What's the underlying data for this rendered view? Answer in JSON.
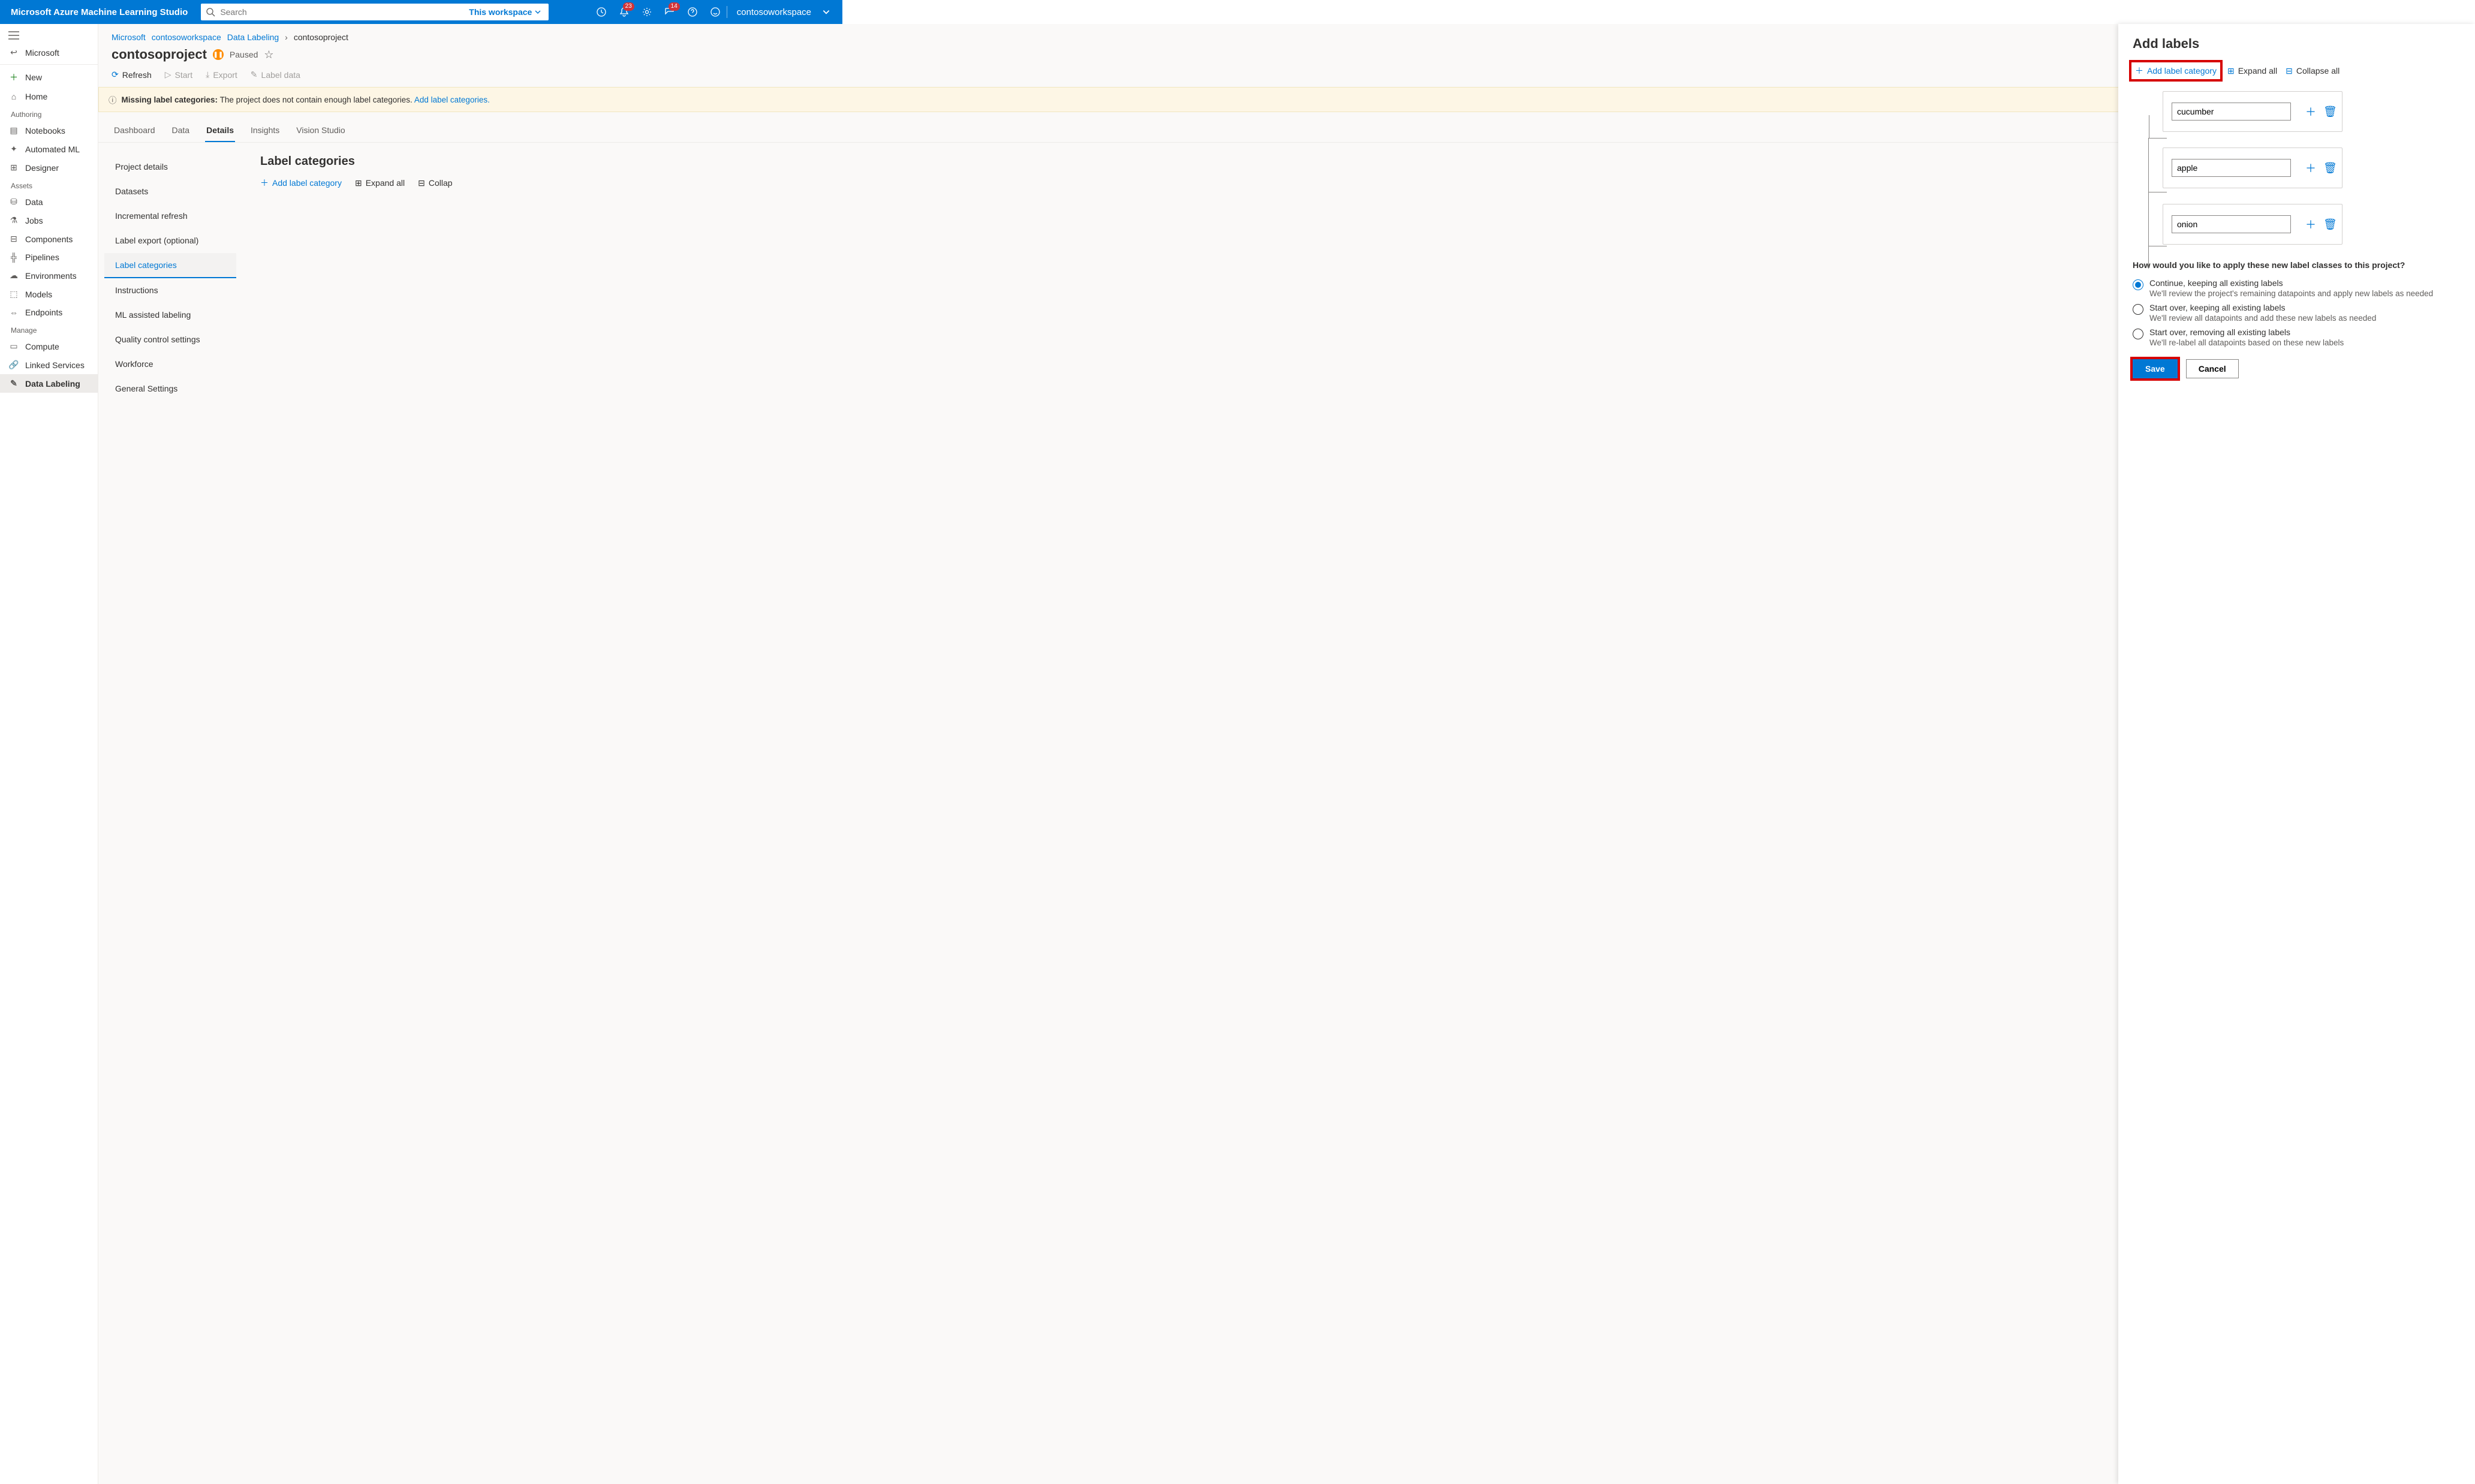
{
  "app_title": "Microsoft Azure Machine Learning Studio",
  "search": {
    "placeholder": "Search",
    "scope": "This workspace"
  },
  "topbar": {
    "bell_badge": "23",
    "feedback_badge": "14",
    "workspace": "contosoworkspace"
  },
  "leftnav": {
    "back": "Microsoft",
    "new": "New",
    "home": "Home",
    "sec_authoring": "Authoring",
    "notebooks": "Notebooks",
    "automl": "Automated ML",
    "designer": "Designer",
    "sec_assets": "Assets",
    "data": "Data",
    "jobs": "Jobs",
    "components": "Components",
    "pipelines": "Pipelines",
    "environments": "Environments",
    "models": "Models",
    "endpoints": "Endpoints",
    "sec_manage": "Manage",
    "compute": "Compute",
    "linked": "Linked Services",
    "labeling": "Data Labeling"
  },
  "crumbs": {
    "a": "Microsoft",
    "b": "contosoworkspace",
    "c": "Data Labeling",
    "d": "contosoproject"
  },
  "project": {
    "name": "contosoproject",
    "status": "Paused"
  },
  "toolbar": {
    "refresh": "Refresh",
    "start": "Start",
    "export": "Export",
    "label": "Label data"
  },
  "banner": {
    "lead": "Missing label categories:",
    "msg": "The project does not contain enough label categories.",
    "link": "Add label categories."
  },
  "tabs": {
    "dashboard": "Dashboard",
    "data": "Data",
    "details": "Details",
    "insights": "Insights",
    "vision": "Vision Studio"
  },
  "subnav": {
    "pd": "Project details",
    "ds": "Datasets",
    "ir": "Incremental refresh",
    "le": "Label export (optional)",
    "lc": "Label categories",
    "ins": "Instructions",
    "ml": "ML assisted labeling",
    "qc": "Quality control settings",
    "wf": "Workforce",
    "gs": "General Settings"
  },
  "panel": {
    "title": "Label categories",
    "add": "Add label category",
    "expand": "Expand all",
    "collapse": "Collap"
  },
  "flyout": {
    "title": "Add labels",
    "add": "Add label category",
    "expand": "Expand all",
    "collapse": "Collapse all",
    "labels": [
      "cucumber",
      "apple",
      "onion"
    ],
    "colors": [
      "#3b0764",
      "#e3008c",
      "#003a8c"
    ],
    "question": "How would you like to apply these new label classes to this project?",
    "opts": [
      {
        "t": "Continue, keeping all existing labels",
        "s": "We'll review the project's remaining datapoints and apply new labels as needed"
      },
      {
        "t": "Start over, keeping all existing labels",
        "s": "We'll review all datapoints and add these new labels as needed"
      },
      {
        "t": "Start over, removing all existing labels",
        "s": "We'll re-label all datapoints based on these new labels"
      }
    ],
    "save": "Save",
    "cancel": "Cancel"
  }
}
